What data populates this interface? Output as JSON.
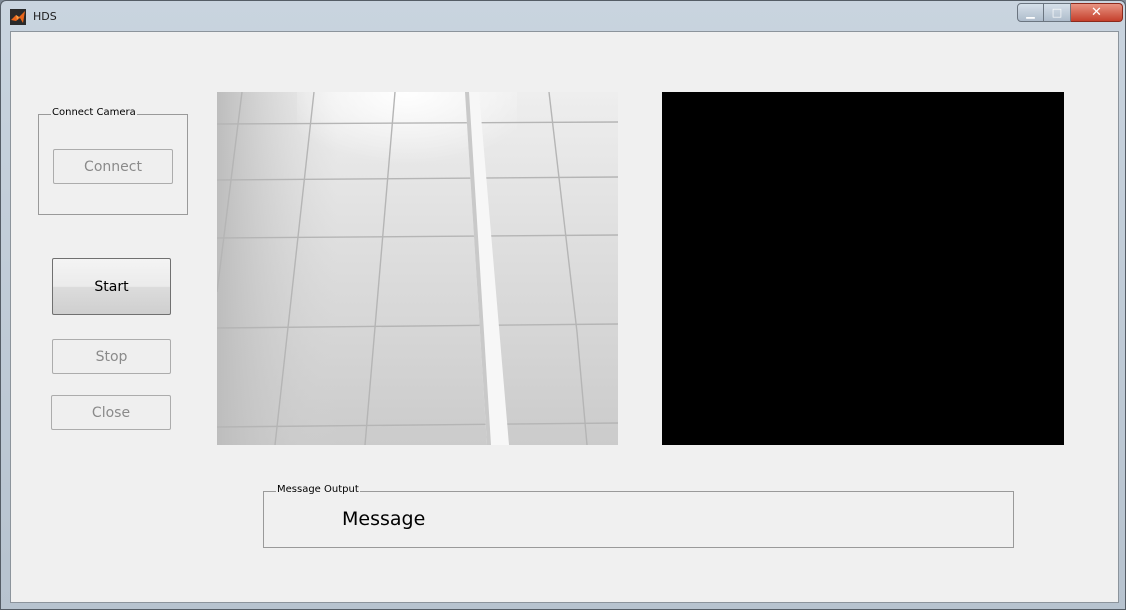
{
  "window": {
    "title": "HDS",
    "controls": {
      "minimize": "▁",
      "maximize": "□",
      "close": "✕"
    }
  },
  "connect_panel": {
    "title": "Connect Camera",
    "connect_label": "Connect"
  },
  "buttons": {
    "start_label": "Start",
    "stop_label": "Stop",
    "close_label": "Close"
  },
  "message_panel": {
    "title": "Message Output",
    "message": "Message"
  },
  "icons": {
    "app": "matlab-logo-icon"
  },
  "colors": {
    "client_bg": "#f0f0f0",
    "output_bg": "#000000"
  }
}
